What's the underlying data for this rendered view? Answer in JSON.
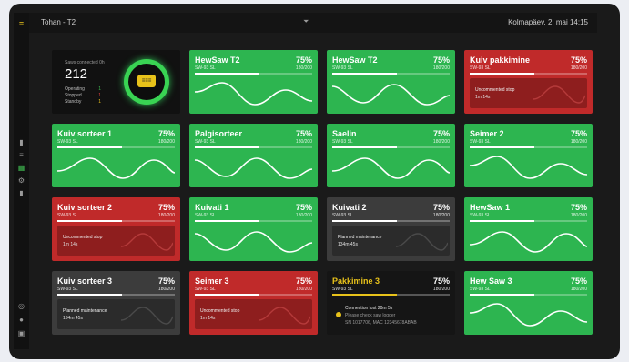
{
  "topbar": {
    "title": "Tohan - T2",
    "filter_icon": "filter-icon",
    "datetime": "Kolmapäev, 2. mai 14:15"
  },
  "sidebar": {
    "logo_icon": "menu-icon",
    "items": [
      {
        "icon": "chart-icon",
        "glyph": "▮"
      },
      {
        "icon": "list-icon",
        "glyph": "≡"
      },
      {
        "icon": "grid-icon",
        "glyph": "▦"
      },
      {
        "icon": "settings-icon",
        "glyph": "⚙"
      },
      {
        "icon": "report-icon",
        "glyph": "▮"
      }
    ],
    "bottom": [
      {
        "icon": "globe-icon",
        "glyph": "◎"
      },
      {
        "icon": "user-icon",
        "glyph": "●"
      },
      {
        "icon": "logout-icon",
        "glyph": "▣"
      }
    ]
  },
  "summary": {
    "label": "Saws connected 0h",
    "value": "212",
    "rows": [
      {
        "label": "Operating",
        "value": "1"
      },
      {
        "label": "Stopped",
        "value": "1"
      },
      {
        "label": "Standby",
        "value": "1"
      }
    ],
    "badge": "≡≡≡"
  },
  "colors": {
    "green": "#2db550",
    "red": "#c02a2a",
    "gray": "#3c3c3c",
    "dark": "#151515",
    "accent": "#e8c21a"
  },
  "cards": [
    {
      "name": "HewSaw T2",
      "pct": "75%",
      "progress": 0.55,
      "sub": "SW-93 SL",
      "count": "180/200",
      "status": "green",
      "wave": 0
    },
    {
      "name": "HewSaw T2",
      "pct": "75%",
      "progress": 0.55,
      "sub": "SW-93 SL",
      "count": "180/200",
      "status": "green",
      "wave": 1
    },
    {
      "name": "Kuiv pakkimine",
      "pct": "75%",
      "progress": 0.55,
      "sub": "SW-93 SL",
      "count": "180/200",
      "status": "red",
      "msg1": "Uncommented stop",
      "msg2": "1m 14s"
    },
    {
      "name": "Kuiv sorteer 1",
      "pct": "75%",
      "progress": 0.55,
      "sub": "SW-93 SL",
      "count": "180/200",
      "status": "green",
      "wave": 2
    },
    {
      "name": "Palgisorteer",
      "pct": "75%",
      "progress": 0.55,
      "sub": "SW-93 SL",
      "count": "180/200",
      "status": "green",
      "wave": 1
    },
    {
      "name": "Saelin",
      "pct": "75%",
      "progress": 0.55,
      "sub": "SW-93 SL",
      "count": "180/200",
      "status": "green",
      "wave": 2
    },
    {
      "name": "Seimer 2",
      "pct": "75%",
      "progress": 0.55,
      "sub": "SW-93 SL",
      "count": "180/200",
      "status": "green",
      "wave": 0
    },
    {
      "name": "Kuiv sorteer 2",
      "pct": "75%",
      "progress": 0.55,
      "sub": "SW-93 SL",
      "count": "180/200",
      "status": "red",
      "msg1": "Uncommented stop",
      "msg2": "1m 14s"
    },
    {
      "name": "Kuivati 1",
      "pct": "75%",
      "progress": 0.55,
      "sub": "SW-93 SL",
      "count": "180/200",
      "status": "green",
      "wave": 1
    },
    {
      "name": "Kuivati 2",
      "pct": "75%",
      "progress": 0.55,
      "sub": "SW-93 SL",
      "count": "180/200",
      "status": "gray",
      "msg1": "Planned maintenance",
      "msg2": "134m 45s"
    },
    {
      "name": "HewSaw 1",
      "pct": "75%",
      "progress": 0.55,
      "sub": "SW-93 SL",
      "count": "180/200",
      "status": "green",
      "wave": 2
    },
    {
      "name": "Kuiv sorteer 3",
      "pct": "75%",
      "progress": 0.55,
      "sub": "SW-93 SL",
      "count": "180/200",
      "status": "gray",
      "msg1": "Planned maintenance",
      "msg2": "134m 45s"
    },
    {
      "name": "Seimer 3",
      "pct": "75%",
      "progress": 0.55,
      "sub": "SW-93 SL",
      "count": "180/200",
      "status": "red",
      "msg1": "Uncommented stop",
      "msg2": "1m 14s"
    },
    {
      "name": "Pakkimine 3",
      "pct": "75%",
      "progress": 0.55,
      "sub": "SW-93 SL",
      "count": "180/200",
      "status": "dark",
      "c1": "Connection lost 20m 5s",
      "c2": "Please check saw logger",
      "c3": "SN 1017706, MAC 12345678ABAB"
    },
    {
      "name": "Hew Saw 3",
      "pct": "75%",
      "progress": 0.55,
      "sub": "SW-93 SL",
      "count": "180/200",
      "status": "green",
      "wave": 0
    }
  ]
}
